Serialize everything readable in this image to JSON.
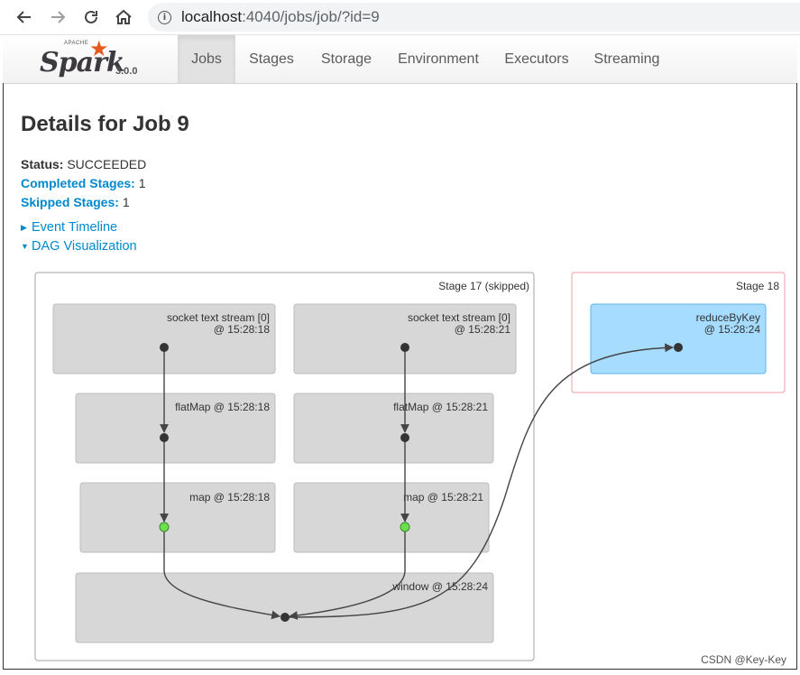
{
  "browser": {
    "back_icon": "arrow-left-icon",
    "forward_icon": "arrow-right-icon",
    "reload_icon": "reload-icon",
    "home_icon": "home-icon",
    "url_host": "localhost",
    "url_path": ":4040/jobs/job/?id=9"
  },
  "navbar": {
    "logo_apache": "APACHE",
    "logo_spark": "Spark",
    "version": "3.0.0",
    "tabs": [
      {
        "label": "Jobs",
        "active": true
      },
      {
        "label": "Stages",
        "active": false
      },
      {
        "label": "Storage",
        "active": false
      },
      {
        "label": "Environment",
        "active": false
      },
      {
        "label": "Executors",
        "active": false
      },
      {
        "label": "Streaming",
        "active": false
      }
    ]
  },
  "page": {
    "title": "Details for Job 9",
    "status_label": "Status:",
    "status_value": "SUCCEEDED",
    "completed_label": "Completed Stages:",
    "completed_value": "1",
    "skipped_label": "Skipped Stages:",
    "skipped_value": "1",
    "event_timeline": "Event Timeline",
    "dag_visualization": "DAG Visualization"
  },
  "dag": {
    "stages": [
      {
        "label": "Stage 17 (skipped)"
      },
      {
        "label": "Stage 18"
      }
    ],
    "ops": [
      {
        "line1": "socket text stream [0]",
        "line2": "@ 15:28:18"
      },
      {
        "line1": "socket text stream [0]",
        "line2": "@ 15:28:21"
      },
      {
        "line1": "flatMap @ 15:28:18",
        "line2": ""
      },
      {
        "line1": "flatMap @ 15:28:21",
        "line2": ""
      },
      {
        "line1": "map @ 15:28:18",
        "line2": ""
      },
      {
        "line1": "map @ 15:28:21",
        "line2": ""
      },
      {
        "line1": "window @ 15:28:24",
        "line2": ""
      },
      {
        "line1": "reduceByKey",
        "line2": "@ 15:28:24"
      }
    ]
  },
  "watermark": "CSDN @Key-Key",
  "colors": {
    "link": "#0088cc",
    "op_box": "#d7d7d7",
    "active_op_box": "#a5dcff",
    "cached_node": "#6ae04c",
    "stage18_border": "#ee9ca7"
  }
}
